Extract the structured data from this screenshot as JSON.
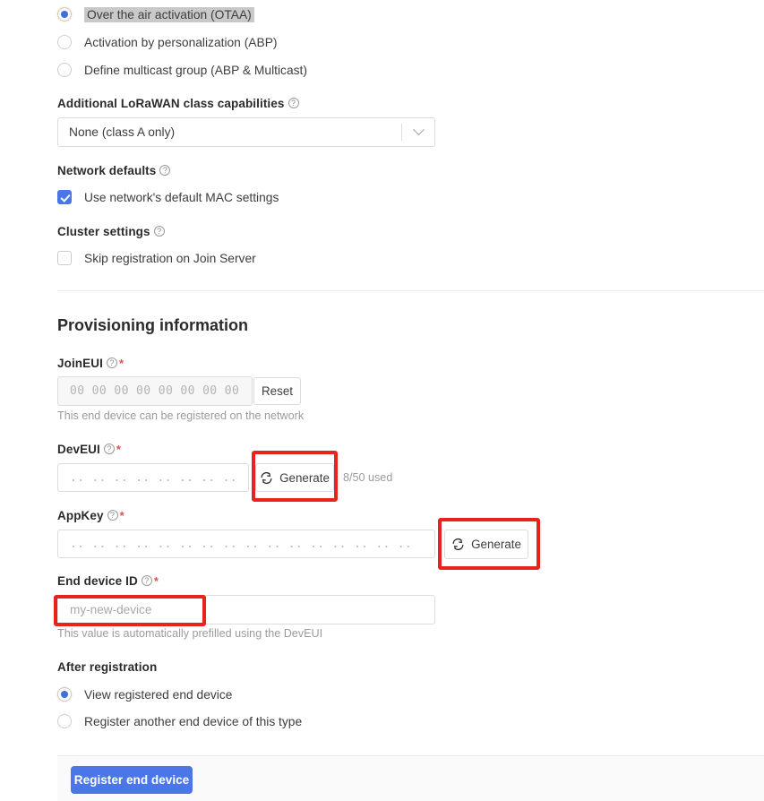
{
  "activation": {
    "options": [
      {
        "label": "Over the air activation (OTAA)",
        "selected": true,
        "highlighted": true
      },
      {
        "label": "Activation by personalization (ABP)",
        "selected": false,
        "highlighted": false
      },
      {
        "label": "Define multicast group (ABP & Multicast)",
        "selected": false,
        "highlighted": false
      }
    ]
  },
  "class_capabilities": {
    "label": "Additional LoRaWAN class capabilities",
    "selected_value": "None (class A only)",
    "options": [
      "None (class A only)"
    ]
  },
  "network_defaults": {
    "label": "Network defaults",
    "checkbox_label": "Use network's default MAC settings",
    "checked": true
  },
  "cluster_settings": {
    "label": "Cluster settings",
    "checkbox_label": "Skip registration on Join Server",
    "checked": false
  },
  "provisioning": {
    "heading": "Provisioning information",
    "join_eui": {
      "label": "JoinEUI",
      "value": "00 00 00 00 00 00 00 00",
      "reset_label": "Reset",
      "hint": "This end device can be registered on the network"
    },
    "dev_eui": {
      "label": "DevEUI",
      "placeholder": ".. .. .. .. .. .. .. ..",
      "generate_label": "Generate",
      "usage": "8/50 used"
    },
    "app_key": {
      "label": "AppKey",
      "placeholder": ".. .. .. .. .. .. .. .. .. .. .. .. .. .. .. ..",
      "generate_label": "Generate"
    },
    "end_device_id": {
      "label": "End device ID",
      "placeholder": "my-new-device",
      "hint": "This value is automatically prefilled using the DevEUI"
    }
  },
  "after_registration": {
    "label": "After registration",
    "options": [
      {
        "label": "View registered end device",
        "selected": true
      },
      {
        "label": "Register another end device of this type",
        "selected": false
      }
    ]
  },
  "submit": {
    "label": "Register end device"
  },
  "colors": {
    "accent_blue": "#4a76e8",
    "radio_blue": "#3f6fd8",
    "annotation_red": "#e8231e",
    "required_red": "#d9534f",
    "border_gray": "#dcdcdc",
    "hint_gray": "#9b9b9b",
    "highlight_gray": "#c9c9c9"
  }
}
